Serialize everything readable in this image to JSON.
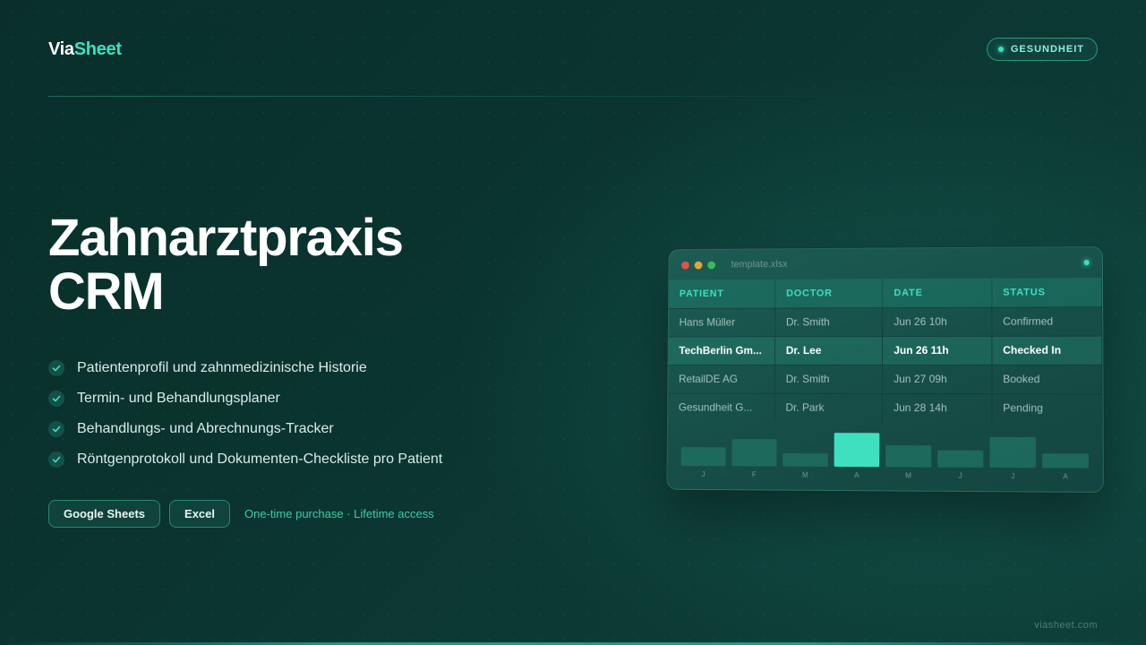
{
  "brand": {
    "part1": "Via",
    "part2": "Sheet"
  },
  "badge": {
    "label": "GESUNDHEIT"
  },
  "hero": {
    "title_line1": "Zahnarztpraxis",
    "title_line2": "CRM"
  },
  "features": [
    "Patientenprofil und zahnmedizinische Historie",
    "Termin- und Behandlungsplaner",
    "Behandlungs- und Abrechnungs-Tracker",
    "Röntgenprotokoll und Dokumenten-Checkliste pro Patient"
  ],
  "actions": {
    "google_sheets": "Google Sheets",
    "excel": "Excel",
    "purchase_note": "One-time purchase · Lifetime access"
  },
  "preview": {
    "filename": "template.xlsx",
    "columns": [
      "PATIENT",
      "DOCTOR",
      "DATE",
      "STATUS"
    ],
    "rows": [
      [
        "Hans Müller",
        "Dr. Smith",
        "Jun 26 10h",
        "Confirmed"
      ],
      [
        "TechBerlin Gm...",
        "Dr. Lee",
        "Jun 26 11h",
        "Checked In"
      ],
      [
        "RetailDE AG",
        "Dr. Smith",
        "Jun 27 09h",
        "Booked"
      ],
      [
        "Gesundheit G...",
        "Dr. Park",
        "Jun 28 14h",
        "Pending"
      ]
    ],
    "highlighted_row": 1
  },
  "chart_data": {
    "type": "bar",
    "categories": [
      "J",
      "F",
      "M",
      "A",
      "M",
      "J",
      "J",
      "A"
    ],
    "values": [
      20,
      29,
      14,
      36,
      23,
      18,
      32,
      15
    ],
    "highlight_index": 3,
    "ylim": [
      0,
      40
    ],
    "grid": false,
    "bar_color": "#1f6e60",
    "highlight_color": "#3ee0c0"
  },
  "colors": {
    "accent": "#3ee0c0",
    "background": "#0b3530"
  },
  "footer": {
    "url": "viasheet.com"
  }
}
